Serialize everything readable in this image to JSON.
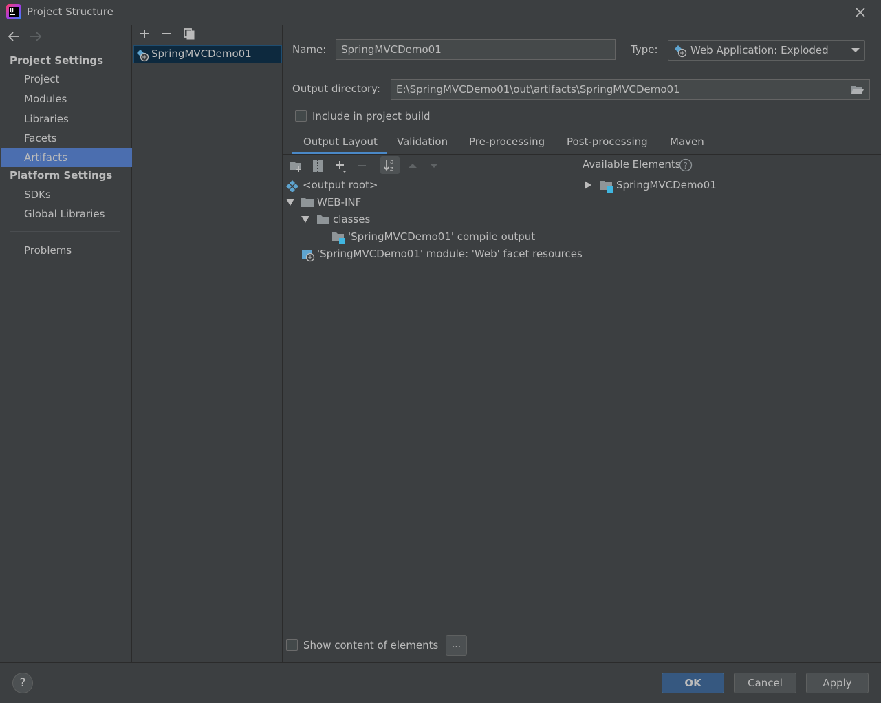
{
  "window": {
    "title": "Project Structure"
  },
  "nav": {
    "project_settings_header": "Project Settings",
    "project_settings_items": [
      "Project",
      "Modules",
      "Libraries",
      "Facets",
      "Artifacts"
    ],
    "selected": "Artifacts",
    "platform_settings_header": "Platform Settings",
    "platform_settings_items": [
      "SDKs",
      "Global Libraries"
    ],
    "problems": "Problems"
  },
  "artifact_list": {
    "items": [
      "SpringMVCDemo01"
    ]
  },
  "form": {
    "name_label": "Name:",
    "name_value": "SpringMVCDemo01",
    "type_label": "Type:",
    "type_value": "Web Application: Exploded",
    "output_dir_label": "Output directory:",
    "output_dir_value": "E:\\SpringMVCDemo01\\out\\artifacts\\SpringMVCDemo01",
    "include_build_label": "Include in project build",
    "include_build_checked": false
  },
  "tabs": {
    "items": [
      "Output Layout",
      "Validation",
      "Pre-processing",
      "Post-processing",
      "Maven"
    ],
    "active": "Output Layout"
  },
  "layout_tree": {
    "root": "<output root>",
    "web_inf": "WEB-INF",
    "classes": "classes",
    "compile_output": "'SpringMVCDemo01' compile output",
    "facet_resources": "'SpringMVCDemo01' module: 'Web' facet resources"
  },
  "available": {
    "header": "Available Elements",
    "items": [
      "SpringMVCDemo01"
    ]
  },
  "show_content_label": "Show content of elements",
  "show_content_checked": false,
  "dots_label": "...",
  "buttons": {
    "ok": "OK",
    "cancel": "Cancel",
    "apply": "Apply",
    "help": "?"
  },
  "colors": {
    "background": "#3c3f41",
    "selection": "#4b6eaf",
    "accent": "#4a88c7",
    "primary_button": "#365880"
  }
}
